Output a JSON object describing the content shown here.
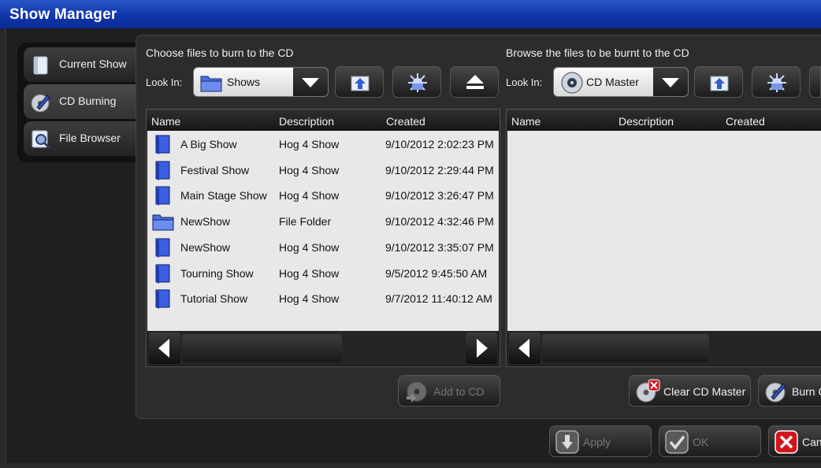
{
  "window": {
    "title": "Show Manager"
  },
  "tabs": [
    {
      "label": "Current Show",
      "icon": "book-icon"
    },
    {
      "label": "CD Burning",
      "icon": "cd-pen-icon",
      "active": true
    },
    {
      "label": "File Browser",
      "icon": "magnifier-icon"
    }
  ],
  "left_pane": {
    "caption": "Choose files to burn to the CD",
    "look_in_label": "Look In:",
    "look_in_value": "Shows",
    "columns": [
      "Name",
      "Description",
      "Created"
    ],
    "rows": [
      {
        "name": "A Big Show",
        "description": "Hog 4 Show",
        "created": "9/10/2012 2:02:23 PM",
        "icon": "show-file-icon"
      },
      {
        "name": "Festival Show",
        "description": "Hog 4 Show",
        "created": "9/10/2012 2:29:44 PM",
        "icon": "show-file-icon"
      },
      {
        "name": "Main Stage Show",
        "description": "Hog 4 Show",
        "created": "9/10/2012 3:26:47 PM",
        "icon": "show-file-icon"
      },
      {
        "name": "NewShow",
        "description": "File Folder",
        "created": "9/10/2012 4:32:46 PM",
        "icon": "folder-icon"
      },
      {
        "name": "NewShow",
        "description": "Hog 4 Show",
        "created": "9/10/2012 3:35:07 PM",
        "icon": "show-file-icon"
      },
      {
        "name": "Tourning Show",
        "description": "Hog 4 Show",
        "created": "9/5/2012 9:45:50 AM",
        "icon": "show-file-icon"
      },
      {
        "name": "Tutorial Show",
        "description": "Hog 4 Show",
        "created": "9/7/2012 11:40:12 AM",
        "icon": "show-file-icon"
      }
    ],
    "add_button": "Add to CD"
  },
  "right_pane": {
    "caption": "Browse the files to be burnt to the CD",
    "look_in_label": "Look In:",
    "look_in_value": "CD Master",
    "columns": [
      "Name",
      "Description",
      "Created"
    ],
    "clear_button": "Clear CD Master",
    "burn_button": "Burn C"
  },
  "footer": {
    "apply": "Apply",
    "ok": "OK",
    "cancel": "Can"
  },
  "colors": {
    "title_bar": "#0f34a8",
    "list_background": "#e8e8e8",
    "folder_blue": "#4d6fe0",
    "cancel_red": "#d4141c"
  }
}
